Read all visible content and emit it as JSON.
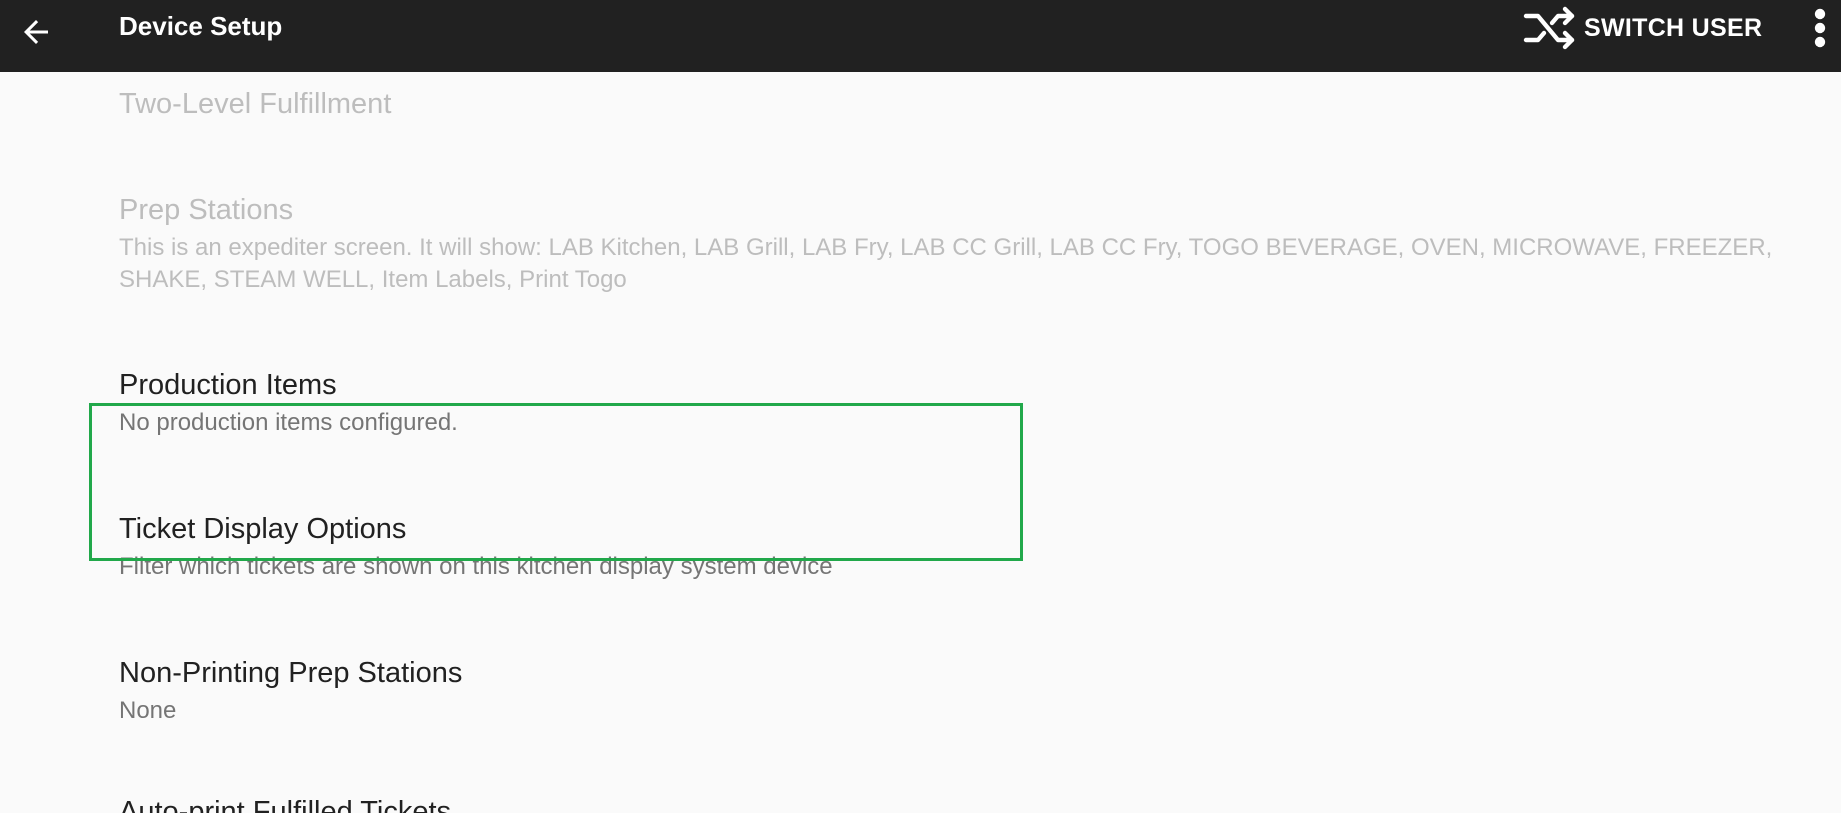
{
  "header": {
    "title": "Device Setup",
    "back_icon": "arrow-left-icon",
    "switch_user_icon": "shuffle-icon",
    "switch_user_label": "SWITCH USER",
    "overflow_icon": "more-vert-icon"
  },
  "preferences": [
    {
      "title": "Two-Level Fulfillment",
      "summary": "",
      "enabled": false
    },
    {
      "title": "Prep Stations",
      "summary": "This is an expediter screen. It will show: LAB Kitchen, LAB Grill, LAB Fry, LAB CC Grill, LAB CC Fry, TOGO BEVERAGE, OVEN, MICROWAVE, FREEZER, SHAKE, STEAM WELL, Item Labels, Print Togo",
      "enabled": false
    },
    {
      "title": "Production Items",
      "summary": "No production items configured.",
      "enabled": true
    },
    {
      "title": "Ticket Display Options",
      "summary": "Filter which tickets are shown on this kitchen display system device",
      "enabled": true,
      "highlighted": true
    },
    {
      "title": "Non-Printing Prep Stations",
      "summary": "None",
      "enabled": true
    },
    {
      "title": "Auto-print Fulfilled Tickets",
      "summary": "",
      "enabled": true
    }
  ],
  "colors": {
    "toolbar": "#212121",
    "highlight": "#21a84a"
  }
}
